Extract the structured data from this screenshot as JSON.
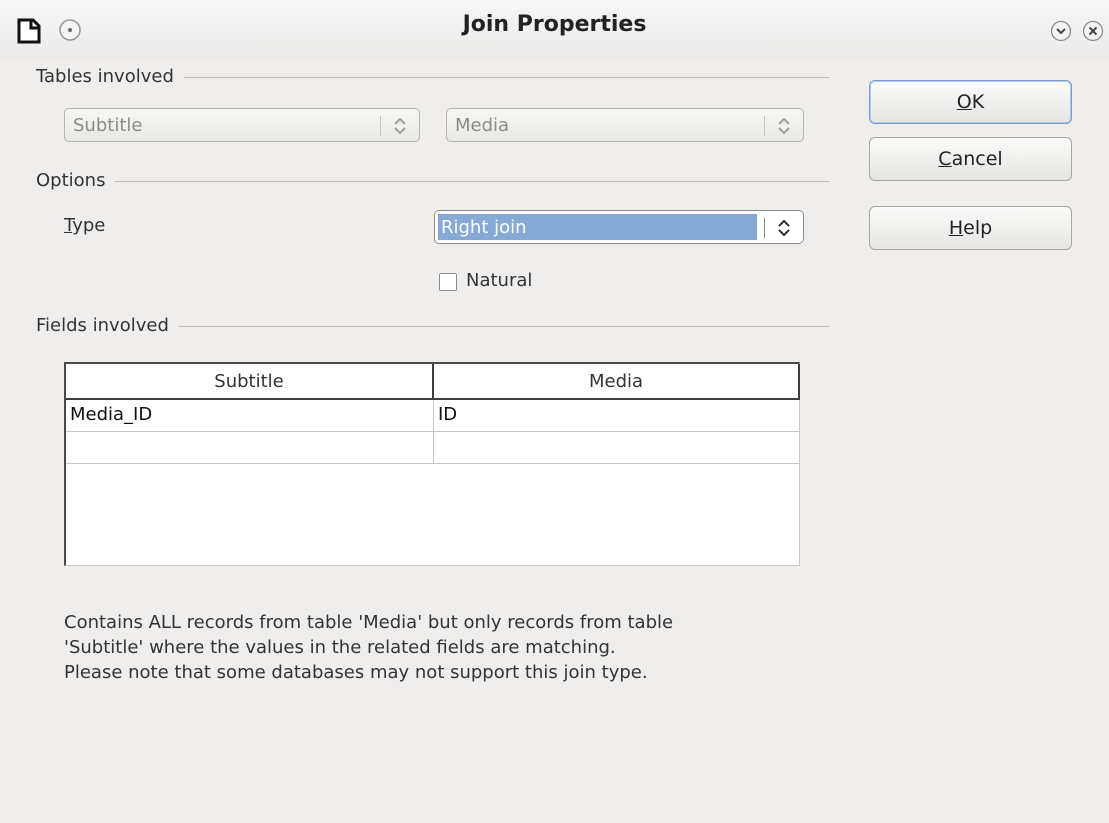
{
  "window": {
    "title": "Join Properties",
    "icons": [
      "document-icon",
      "window-menu-icon",
      "minimize-icon",
      "close-icon"
    ]
  },
  "tables_involved": {
    "group_label": "Tables involved",
    "left_table": "Subtitle",
    "right_table": "Media"
  },
  "options": {
    "group_label": "Options",
    "type_label_underline": "T",
    "type_label_rest": "ype",
    "type_value": "Right join",
    "natural_label": "Natural",
    "natural_checked": false
  },
  "fields_involved": {
    "group_label": "Fields involved",
    "columns": [
      "Subtitle",
      "Media"
    ],
    "rows": [
      [
        "Media_ID",
        "ID"
      ],
      [
        "",
        ""
      ]
    ]
  },
  "description": [
    "Contains ALL records from table 'Media' but only records from table",
    "'Subtitle' where the values in the related fields are matching.",
    "Please note that some databases may not support this join type."
  ],
  "buttons": {
    "ok": {
      "underline": "O",
      "rest": "K"
    },
    "cancel": {
      "underline": "C",
      "rest": "ancel"
    },
    "help": {
      "underline": "H",
      "rest": "elp"
    }
  },
  "colors": {
    "selection": "#86a9d8",
    "dialog_bg": "#efeeed"
  }
}
